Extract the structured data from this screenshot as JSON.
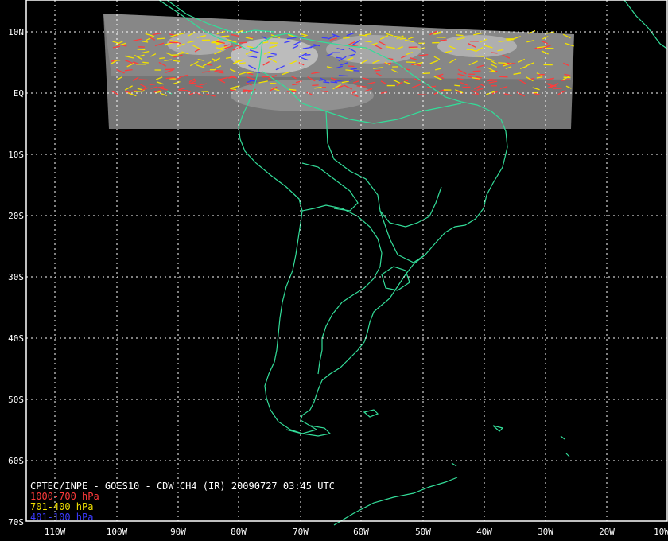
{
  "map": {
    "lat_labels": [
      "10N",
      "EQ",
      "10S",
      "20S",
      "30S",
      "40S",
      "50S",
      "60S",
      "70S"
    ],
    "lon_labels": [
      "110W",
      "100W",
      "90W",
      "80W",
      "70W",
      "60W",
      "50W",
      "40W",
      "30W",
      "20W",
      "10W"
    ],
    "colors": {
      "background": "#000000",
      "coast": "#33dd99",
      "grid": "#ffffff",
      "frame": "#ffffff",
      "satellite_strip": "#8a8a8a"
    }
  },
  "caption": {
    "title": "CPTEC/INPE - GOES10 - CDW CH4 (IR) 20090727 03:45 UTC"
  },
  "legend": [
    {
      "label": "1000-700 hPa",
      "color": "#ff3b3b"
    },
    {
      "label": "701-400 hPa",
      "color": "#f2e200"
    },
    {
      "label": "401-100 hPa",
      "color": "#3b3bff"
    }
  ]
}
